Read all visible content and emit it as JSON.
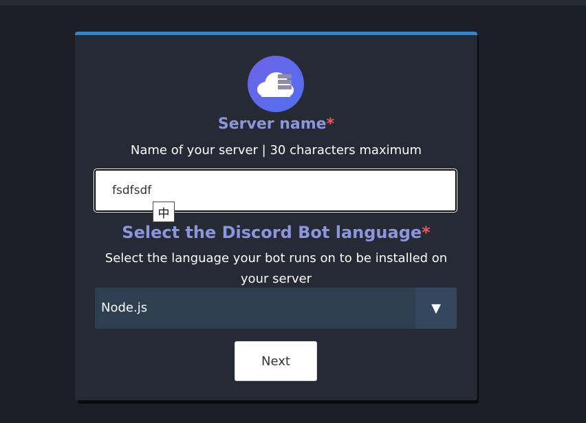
{
  "form": {
    "logo_icon": "cloud-server-icon",
    "server_name": {
      "title": "Server name",
      "required_mark": "*",
      "description": "Name of your server | 30 characters maximum",
      "value": "fsdfsdf"
    },
    "ime_indicator": "中",
    "language": {
      "title": "Select the Discord Bot language",
      "required_mark": "*",
      "description": "Select the language your bot runs on to be installed on your server",
      "selected": "Node.js",
      "arrow": "▼"
    },
    "next_label": "Next"
  },
  "colors": {
    "accent_blue": "#3d84c6",
    "title_color": "#8b96df",
    "required_red": "#e85a5f",
    "card_bg": "#252a35",
    "select_bg": "#2e3f52"
  }
}
